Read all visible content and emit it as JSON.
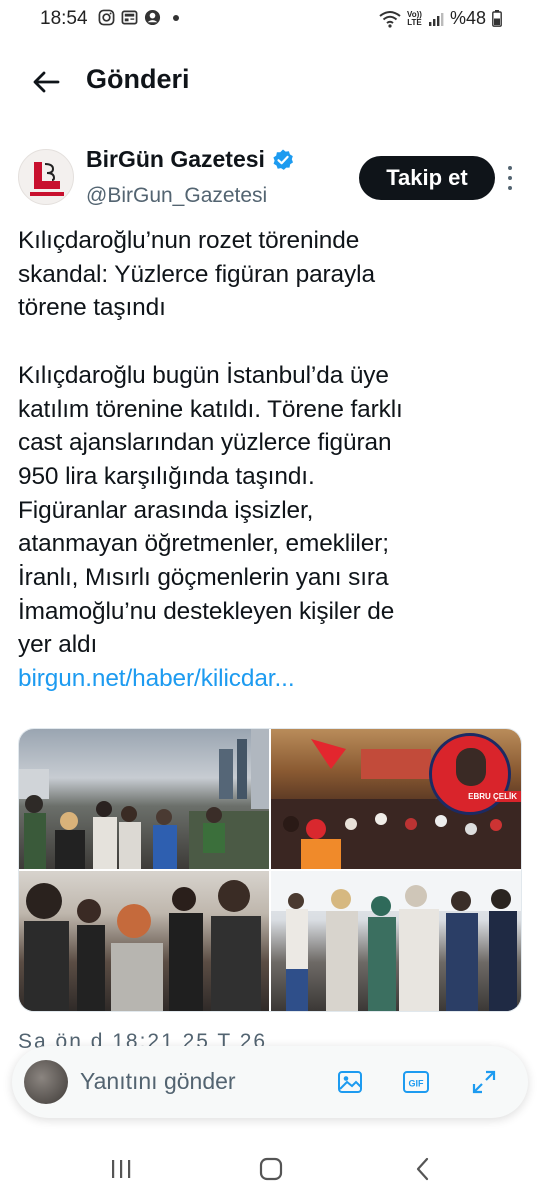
{
  "status_bar": {
    "time": "18:54",
    "battery": "%48",
    "left_icons": [
      "instagram-icon",
      "news-icon",
      "account-icon"
    ],
    "right_icons": [
      "wifi-icon",
      "volte-icon",
      "signal-icon",
      "battery-icon"
    ],
    "volte_label_top": "Vo))",
    "volte_label_bottom": "LTE"
  },
  "header": {
    "title": "Gönderi",
    "back_icon": "arrow-left-icon"
  },
  "post": {
    "author_name": "BirGün Gazetesi",
    "author_handle": "@BirGun_Gazetesi",
    "verified_icon": "verified-badge-icon",
    "follow_label": "Takip et",
    "more_icon": "more-vertical-icon",
    "text_lines_1": [
      "Kılıçdaroğlu’nun rozet töreninde",
      "skandal: Yüzlerce figüran parayla",
      "törene taşındı"
    ],
    "text_lines_2": [
      "Kılıçdaroğlu bugün İstanbul’da üye",
      "katılım törenine katıldı. Törene farklı",
      "cast ajanslarından yüzlerce figüran",
      "950 lira karşılığında taşındı.",
      "Figüranlar arasında işsizler,",
      "atanmayan öğretmenler, emekliler;",
      "İranlı, Mısırlı göçmenlerin yanı sıra",
      "İmamoğlu’nu destekleyen kişiler de",
      "yer aldı"
    ],
    "link": "birgun.net/haber/kilicdar...",
    "media_badge_label": "EBRU ÇELİK",
    "timestamp_partial": "Sa  ön  d    18:21  25 T    26"
  },
  "reply_bar": {
    "placeholder": "Yanıtını gönder",
    "icons": [
      "image-icon",
      "gif-icon",
      "expand-icon"
    ],
    "gif_label": "GIF"
  },
  "nav_bar": {
    "icons": [
      "recent-apps-icon",
      "home-icon",
      "back-icon"
    ]
  },
  "colors": {
    "accent": "#1d9bf0",
    "follow_bg": "#0f1419",
    "text": "#0f1419",
    "secondary_text": "#536471",
    "logo_red": "#c8102e"
  }
}
